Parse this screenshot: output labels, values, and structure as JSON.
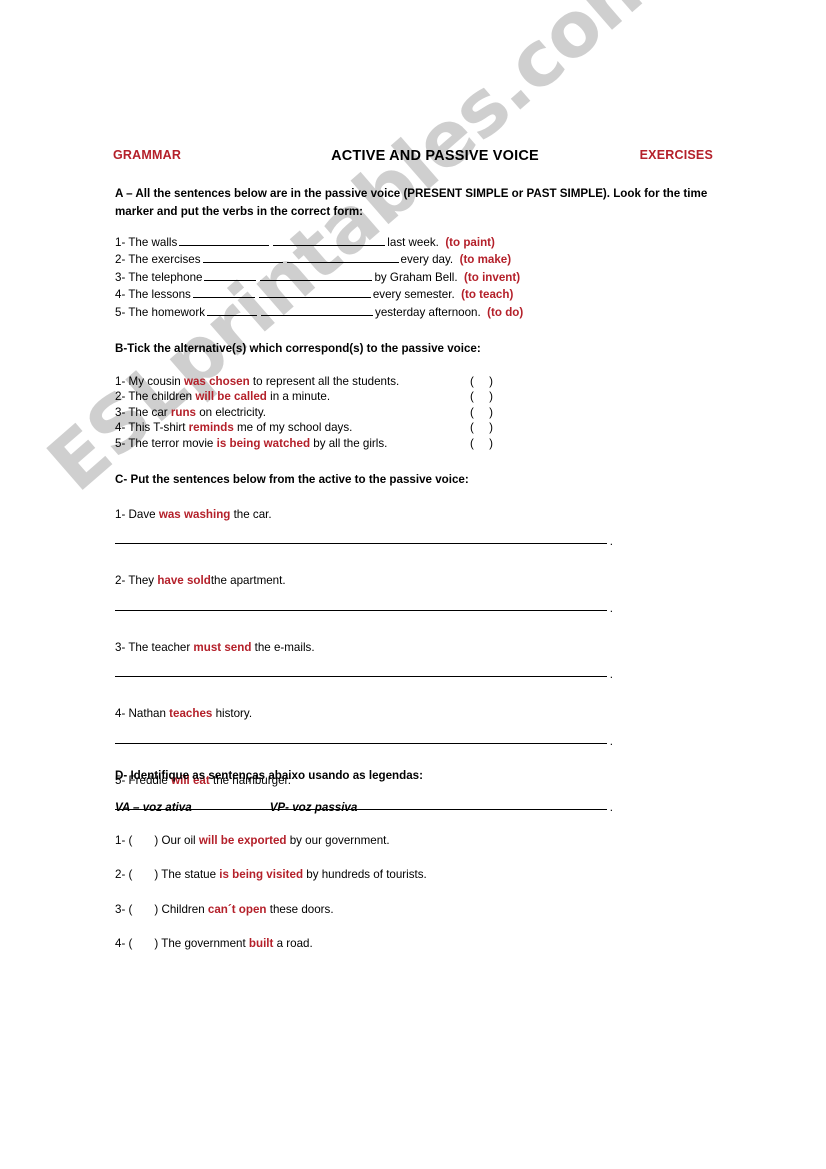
{
  "header": {
    "left_label": "GRAMMAR",
    "title": "ACTIVE AND PASSIVE VOICE",
    "right_label": "EXERCISES",
    "accent_color": "#b4202a"
  },
  "watermark": {
    "text": "ESLprintables.com",
    "color": "#cfcfcf"
  },
  "sections": {
    "a": {
      "instruction": "A – All the sentences below are in the passive voice (PRESENT SIMPLE or  PAST SIMPLE). Look for the time marker and put the verbs in the correct form:",
      "items": [
        {
          "num": "1-",
          "subject": "The walls",
          "blank1_width": 90,
          "blank2_width": 112,
          "tail": "last week.",
          "verb": "(to paint)"
        },
        {
          "num": "2-",
          "subject": "The exercises",
          "blank1_width": 80,
          "blank2_width": 112,
          "tail": "every day.",
          "verb": "(to make)"
        },
        {
          "num": "3-",
          "subject": "The telephone",
          "blank1_width": 52,
          "blank2_width": 112,
          "tail": "by Graham Bell.",
          "verb": "(to invent)"
        },
        {
          "num": "4-",
          "subject": "The lessons",
          "blank1_width": 62,
          "blank2_width": 112,
          "tail": "every semester.",
          "verb": "(to teach)"
        },
        {
          "num": "5-",
          "subject": "The homework",
          "blank1_width": 50,
          "blank2_width": 112,
          "tail": "yesterday afternoon.",
          "verb": "(to do)"
        }
      ]
    },
    "b": {
      "instruction": "B-Tick the alternative(s) which correspond(s) to the passive voice:",
      "box": "(    )",
      "items": [
        {
          "num": "1-",
          "pre": "My cousin ",
          "verb": "was chosen",
          "post": " to represent all the students."
        },
        {
          "num": "2-",
          "pre": "The children ",
          "verb": "will be called",
          "post": " in a minute."
        },
        {
          "num": "3-",
          "pre": "The car ",
          "verb": "runs",
          "post": " on electricity."
        },
        {
          "num": "4-",
          "pre": "This T-shirt ",
          "verb": "reminds",
          "post": " me of my school days."
        },
        {
          "num": "5-",
          "pre": "The terror movie ",
          "verb": "is being watched",
          "post": " by all the girls."
        }
      ]
    },
    "c": {
      "instruction": "C- Put the sentences below from the active to the passive voice:",
      "answer_end_mark": ".",
      "items": [
        {
          "num": "1-",
          "pre": "Dave ",
          "verb": "was washing",
          "post": " the car."
        },
        {
          "num": "2-",
          "pre": "They ",
          "verb": "have sold",
          "post": "the apartment."
        },
        {
          "num": "3-",
          "pre": "The teacher ",
          "verb": "must send",
          "post": " the e-mails."
        },
        {
          "num": "4-",
          "pre": "Nathan ",
          "verb": "teaches",
          "post": " history."
        },
        {
          "num": "5-",
          "pre": "Freddie ",
          "verb": "will eat",
          "post": " the hamburger."
        }
      ]
    },
    "d": {
      "instruction": "D- Identifique as sentenças abaixo usando as legendas:",
      "legend_active": "VA – voz ativa",
      "legend_passive": "VP- voz passiva",
      "items": [
        {
          "num": "1- (",
          "close": ")",
          "pre": " Our oil ",
          "verb": "will be exported",
          "post": " by our government."
        },
        {
          "num": "2- (",
          "close": ")",
          "pre": " The statue ",
          "verb": "is being visited",
          "post": " by hundreds of tourists."
        },
        {
          "num": "3- (",
          "close": ")",
          "pre": " Children ",
          "verb": "can´t open",
          "post": " these doors."
        },
        {
          "num": "4- (",
          "close": ")",
          "pre": " The government ",
          "verb": "built",
          "post": " a road."
        }
      ]
    }
  }
}
